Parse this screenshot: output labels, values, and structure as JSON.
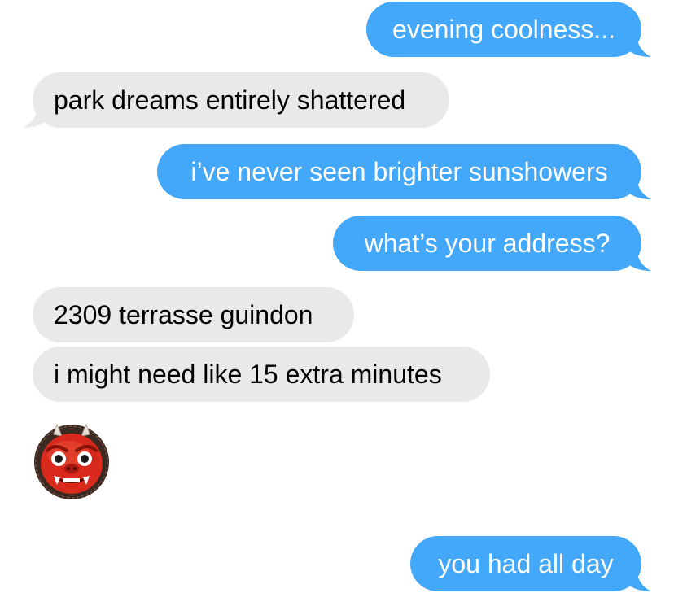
{
  "conversation": {
    "messages": [
      {
        "sender": "me",
        "text": "evening coolness..."
      },
      {
        "sender": "them",
        "text": "park dreams entirely shattered"
      },
      {
        "sender": "me",
        "text": "i’ve never seen brighter sunshowers"
      },
      {
        "sender": "me",
        "text": "what’s your address?"
      },
      {
        "sender": "them",
        "text": "2309 terrasse guindon"
      },
      {
        "sender": "them",
        "text": "i might need like 15 extra minutes"
      },
      {
        "sender": "them",
        "emoji": "ogre-face-emoji"
      },
      {
        "sender": "me",
        "text": "you had all day"
      }
    ]
  },
  "colors": {
    "sent_bubble": "#44a8fa",
    "received_bubble": "#e9e9eb",
    "sent_text": "#ffffff",
    "received_text": "#000000",
    "emoji_face": "#d8291c"
  }
}
